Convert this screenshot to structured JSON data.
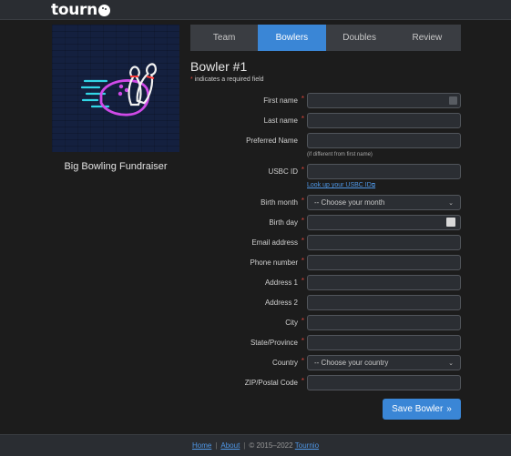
{
  "app": {
    "logo_text": "tourn",
    "logo_icon": "bowling-ball-icon"
  },
  "tournament": {
    "name": "Big Bowling Fundraiser",
    "image": "neon-bowling-sign"
  },
  "tabs": [
    {
      "label": "Team",
      "active": false
    },
    {
      "label": "Bowlers",
      "active": true
    },
    {
      "label": "Doubles",
      "active": false
    },
    {
      "label": "Review",
      "active": false
    }
  ],
  "form": {
    "title": "Bowler #1",
    "required_note": "indicates a required field",
    "required_mark": "*",
    "fields": {
      "first_name": {
        "label": "First name",
        "value": ""
      },
      "last_name": {
        "label": "Last name",
        "value": ""
      },
      "preferred_name": {
        "label": "Preferred Name",
        "value": "",
        "help": "(if different from first name)"
      },
      "usbc_id": {
        "label": "USBC ID",
        "value": "",
        "link": "Look up your USBC ID"
      },
      "birth_month": {
        "label": "Birth month",
        "value": "-- Choose your month"
      },
      "birth_day": {
        "label": "Birth day",
        "value": ""
      },
      "email": {
        "label": "Email address",
        "value": ""
      },
      "phone": {
        "label": "Phone number",
        "value": ""
      },
      "address1": {
        "label": "Address 1",
        "value": ""
      },
      "address2": {
        "label": "Address 2",
        "value": ""
      },
      "city": {
        "label": "City",
        "value": ""
      },
      "state": {
        "label": "State/Province",
        "value": ""
      },
      "country": {
        "label": "Country",
        "value": "-- Choose your country"
      },
      "zip": {
        "label": "ZIP/Postal Code",
        "value": ""
      }
    },
    "save_label": "Save Bowler"
  },
  "footer": {
    "home": "Home",
    "about": "About",
    "copyright": "© 2015–2022",
    "brand": "Tournio"
  },
  "colors": {
    "accent": "#3a86d6",
    "required": "#d9453b",
    "background": "#1c1c1c"
  }
}
